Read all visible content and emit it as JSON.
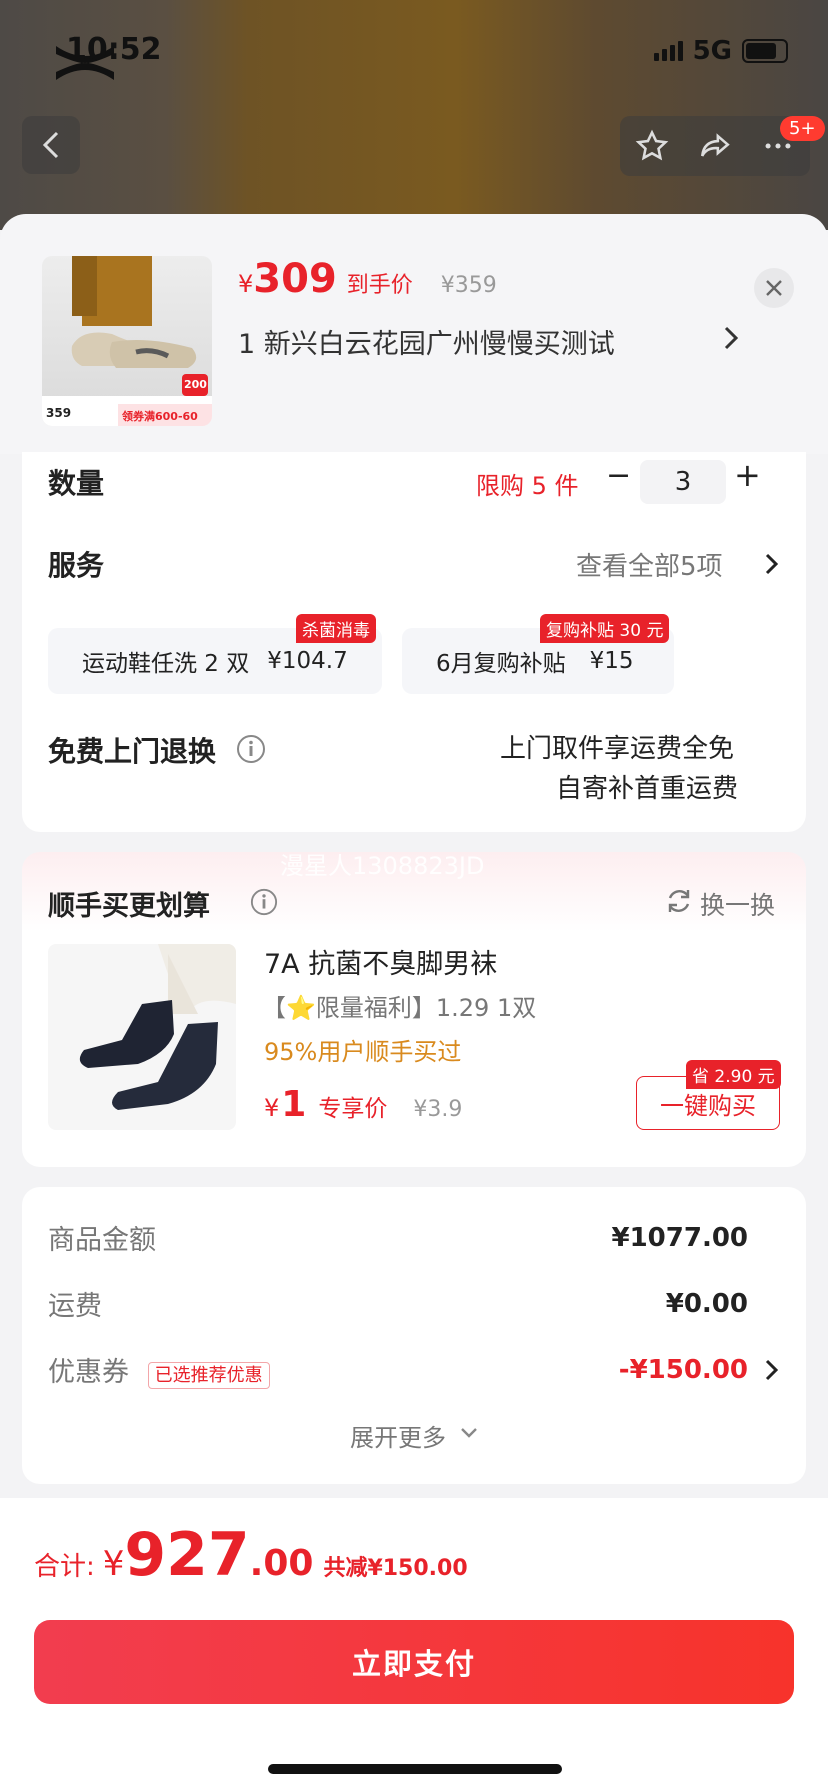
{
  "status_bar": {
    "time": "10:52",
    "network": "5G"
  },
  "top_nav": {
    "badge_count": "5+"
  },
  "product": {
    "thumb_price": "359",
    "thumb_coupon": "领券满600-60",
    "thumb_badge": "200",
    "price_yen": "¥",
    "price_value": "309",
    "price_tag": "到手价",
    "original_price": "¥359",
    "address": "1  新兴白云花园广州慢慢买测试"
  },
  "quantity": {
    "label": "数量",
    "limit": "限购 5 件",
    "value": "3",
    "minus": "−",
    "plus": "+"
  },
  "service": {
    "label": "服务",
    "view_all": "查看全部5项",
    "items": [
      {
        "name": "运动鞋任洗 2 双",
        "price": "¥104.7",
        "badge": "杀菌消毒"
      },
      {
        "name": "6月复购补贴",
        "price": "¥15",
        "badge": "复购补贴 30 元"
      }
    ]
  },
  "return_service": {
    "label": "免费上门退换",
    "line1": "上门取件享运费全免",
    "line2": "自寄补首重运费"
  },
  "watermark": "漫星人1308823JD",
  "addon": {
    "title": "顺手买更划算",
    "refresh": "换一换",
    "item": {
      "name": "7A 抗菌不臭脚男袜",
      "promo": "【⭐限量福利】1.29 1双",
      "social": "95%用户顺手买过",
      "price_yen": "¥",
      "price": "1",
      "price_tag": "专享价",
      "original_price": "¥3.9",
      "save_badge": "省 2.90 元",
      "buy_button": "一键购买"
    }
  },
  "summary": {
    "goods_label": "商品金额",
    "goods_value": "¥1077.00",
    "shipping_label": "运费",
    "shipping_value": "¥0.00",
    "coupon_label": "优惠券",
    "coupon_tag": "已选推荐优惠",
    "coupon_value": "-¥150.00",
    "expand": "展开更多"
  },
  "footer": {
    "total_label": "合计:",
    "total_yen": "¥",
    "total_int": "927",
    "total_dec": ".00",
    "discount": "共减¥150.00",
    "pay_button": "立即支付"
  },
  "colors": {
    "accent": "#e8222a",
    "pay_gradient_start": "#f23d4f",
    "pay_gradient_end": "#f7332b",
    "orange_text": "#d98a1e"
  }
}
